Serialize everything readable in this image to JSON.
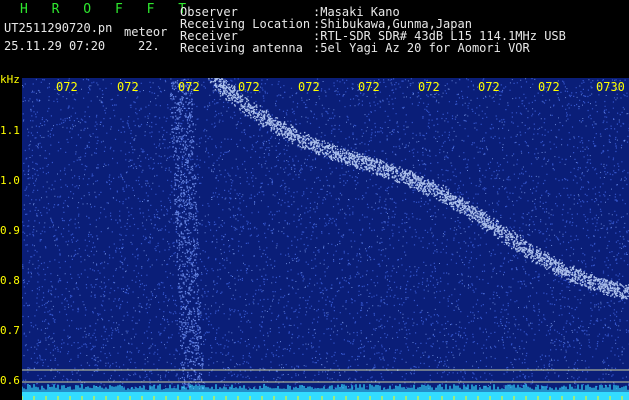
{
  "app": {
    "title": "H R O F F T",
    "filename": "UT2511290720.pn",
    "event_tag": "meteor",
    "timestamp": "25.11.29 07:20",
    "extra": "22."
  },
  "info": {
    "observer_label": "Observer",
    "observer_value": ":Masaki Kano",
    "location_label": "Receiving Location",
    "location_value": ":Shibukawa,Gunma,Japan",
    "receiver_label": "Receiver",
    "receiver_value": ":RTL-SDR SDR# 43dB L15 114.1MHz USB",
    "antenna_label": "Receiving antenna",
    "antenna_value": ":5el Yagi Az 20 for Aomori VOR"
  },
  "time_axis": [
    "072",
    "072",
    "072",
    "072",
    "072",
    "072",
    "072",
    "072",
    "072",
    "0730"
  ],
  "freq_axis": {
    "unit": "kHz",
    "ticks": [
      "1.1",
      "1.0",
      "0.9",
      "0.8",
      "0.7",
      "0.6"
    ]
  },
  "colors": {
    "background": "#000000",
    "spectrum_base": "#0a1e78",
    "signal": "#c8dcff",
    "grid_lines": "#ffffaa",
    "baseline": "#33ddff",
    "axis_text": "#ffff00",
    "header_text": "#e8e8e8",
    "title_text": "#2ee82e"
  }
}
